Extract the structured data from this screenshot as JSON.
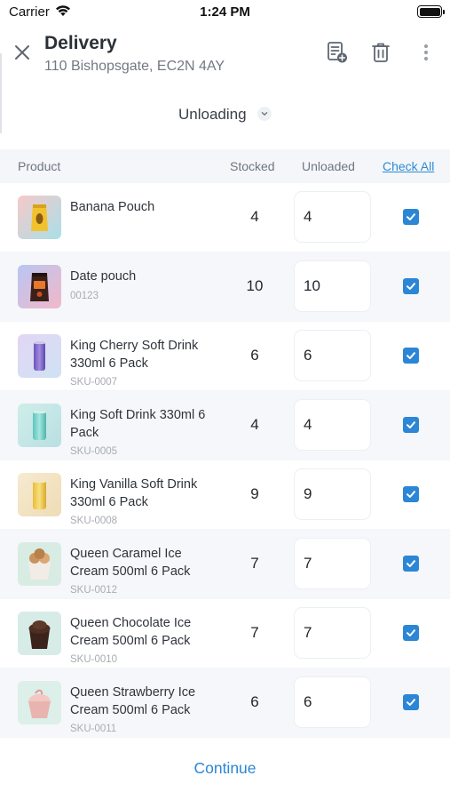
{
  "status_bar": {
    "carrier": "Carrier",
    "time": "1:24 PM"
  },
  "header": {
    "title": "Delivery",
    "address": "110 Bishopsgate, EC2N 4AY",
    "mode": "Unloading"
  },
  "table": {
    "columns": {
      "product": "Product",
      "stocked": "Stocked",
      "unloaded": "Unloaded",
      "check_all": "Check All"
    },
    "rows": [
      {
        "name": "Banana Pouch",
        "sku": "",
        "stocked": "4",
        "unloaded": "4",
        "checked": true,
        "image": "banana-pouch-image"
      },
      {
        "name": "Date pouch",
        "sku": "00123",
        "stocked": "10",
        "unloaded": "10",
        "checked": true,
        "image": "date-pouch-image"
      },
      {
        "name": "King Cherry Soft Drink 330ml 6 Pack",
        "sku": "SKU-0007",
        "stocked": "6",
        "unloaded": "6",
        "checked": true,
        "image": "purple-can-image"
      },
      {
        "name": "King Soft Drink 330ml 6 Pack",
        "sku": "SKU-0005",
        "stocked": "4",
        "unloaded": "4",
        "checked": true,
        "image": "teal-can-image"
      },
      {
        "name": "King Vanilla Soft Drink 330ml 6 Pack",
        "sku": "SKU-0008",
        "stocked": "9",
        "unloaded": "9",
        "checked": true,
        "image": "yellow-can-image"
      },
      {
        "name": "Queen Caramel Ice Cream 500ml 6 Pack",
        "sku": "SKU-0012",
        "stocked": "7",
        "unloaded": "7",
        "checked": true,
        "image": "caramel-ice-cream-image"
      },
      {
        "name": "Queen Chocolate Ice Cream 500ml 6 Pack",
        "sku": "SKU-0010",
        "stocked": "7",
        "unloaded": "7",
        "checked": true,
        "image": "chocolate-ice-cream-image"
      },
      {
        "name": "Queen Strawberry Ice Cream 500ml 6 Pack",
        "sku": "SKU-0011",
        "stocked": "6",
        "unloaded": "6",
        "checked": true,
        "image": "strawberry-ice-cream-image"
      }
    ]
  },
  "footer": {
    "continue_label": "Continue"
  },
  "colors": {
    "accent": "#2b86d6",
    "header_bg": "#f4f6f9",
    "alt_row_bg": "#f6f7fa"
  }
}
